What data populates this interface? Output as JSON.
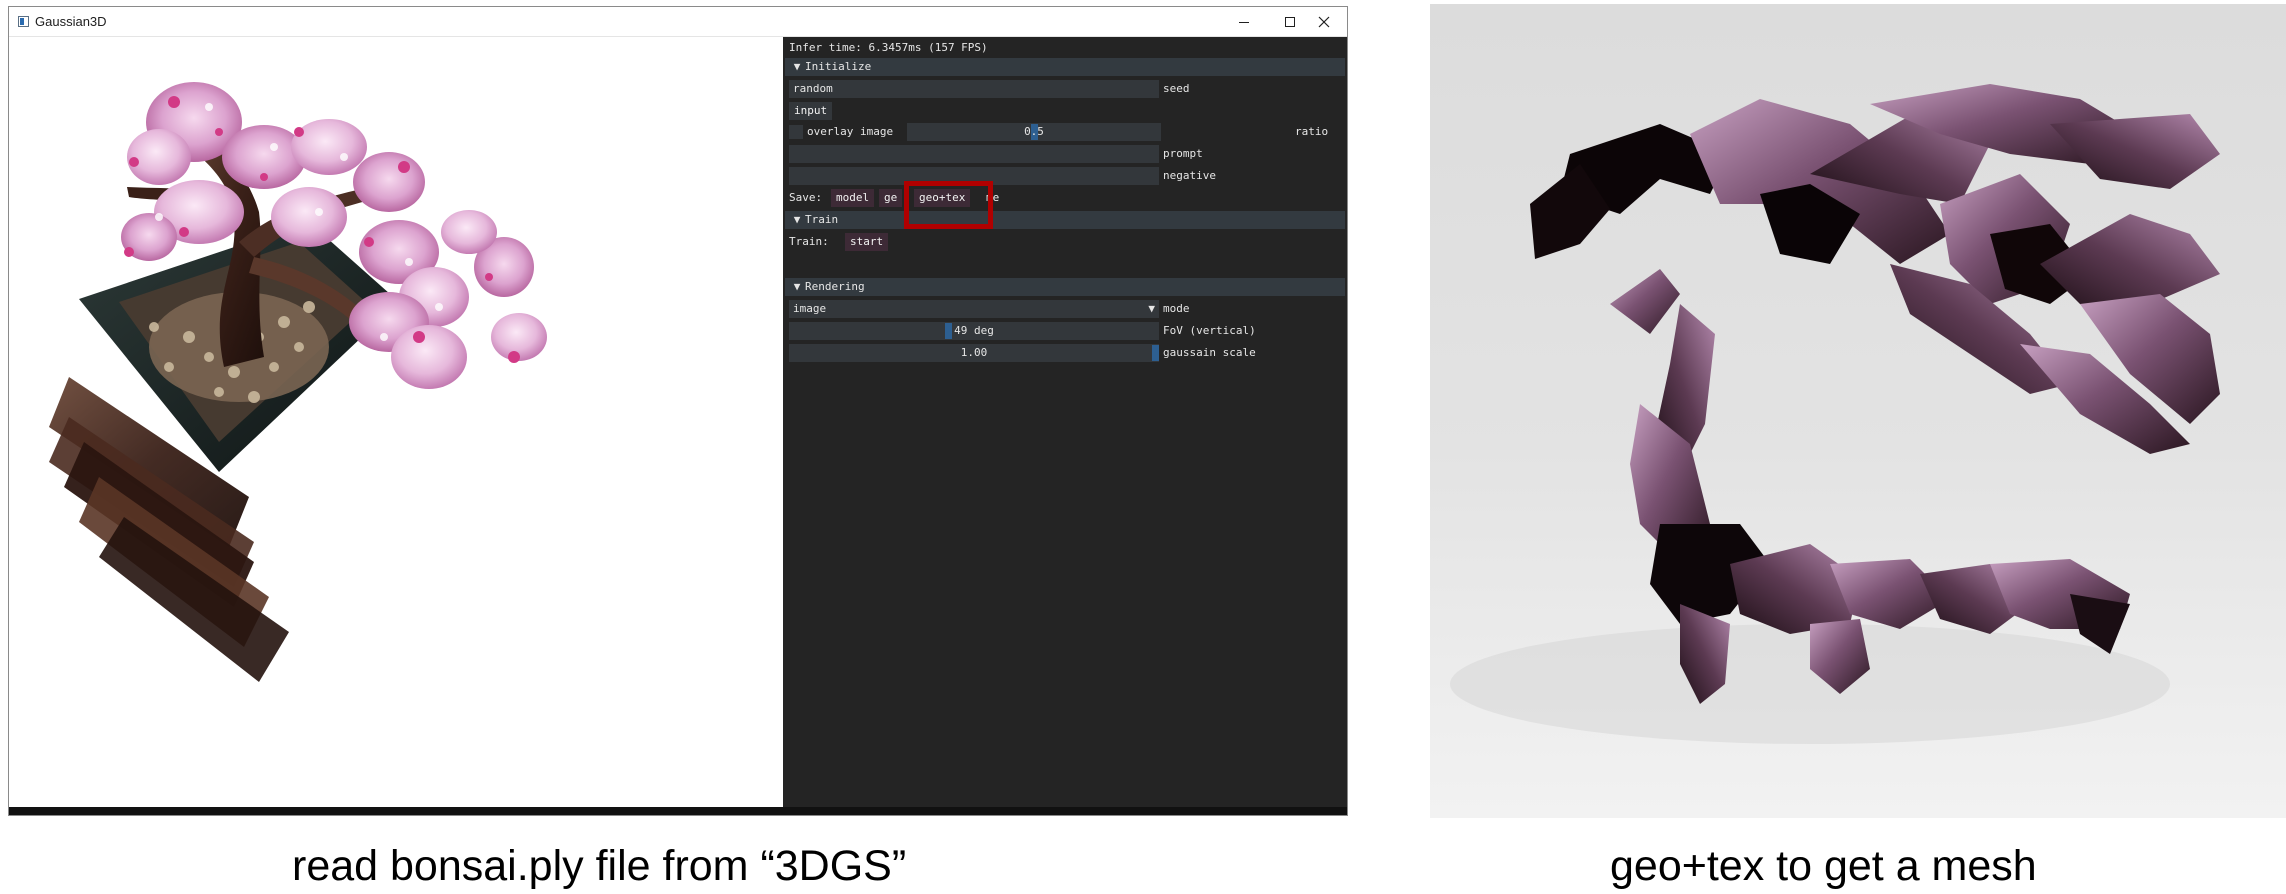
{
  "window": {
    "title": "Gaussian3D"
  },
  "panel": {
    "infer_time": "Infer time:  6.3457ms (157 FPS)",
    "initialize": {
      "header": "Initialize",
      "seed_value": "random",
      "seed_label": "seed",
      "input_label": "input",
      "overlay_label": "overlay image",
      "ratio_value": "0.5",
      "ratio_label": "ratio",
      "prompt_value": "",
      "prompt_label": "prompt",
      "negative_value": "",
      "negative_label": "negative",
      "save_label": "Save:",
      "save_buttons": [
        "model",
        "ge",
        "geo+tex",
        "me"
      ]
    },
    "train": {
      "header": "Train",
      "train_label": "Train:",
      "start_label": "start"
    },
    "rendering": {
      "header": "Rendering",
      "mode_value": "image",
      "mode_label": "mode",
      "fov_value": "49 deg",
      "fov_label": "FoV (vertical)",
      "scale_value": "1.00",
      "scale_label": "gaussain scale"
    }
  },
  "captions": {
    "left": "read bonsai.ply file from “3DGS”",
    "right": "geo+tex to get a mesh"
  },
  "colors": {
    "panel_bg": "#242424",
    "header_bg": "#333a40",
    "button_bg": "#3d2a36",
    "highlight": "#b00000",
    "blossom": "#d88fc4"
  },
  "icons": [
    "app-icon",
    "minimize-icon",
    "maximize-icon",
    "close-icon",
    "collapse-arrow-icon",
    "combo-arrow-icon"
  ]
}
